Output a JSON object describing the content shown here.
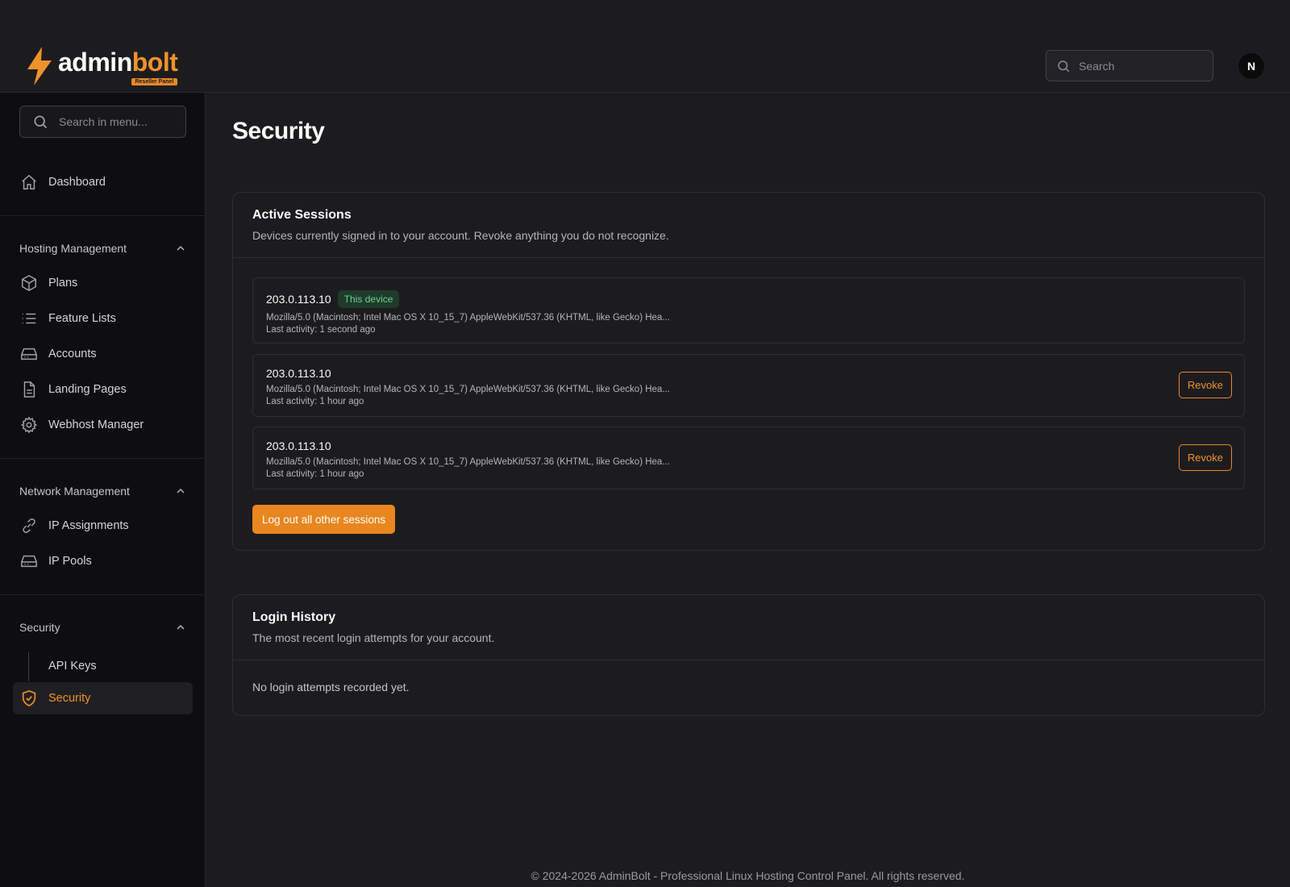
{
  "brand": {
    "name_part1": "admin",
    "name_part2": "bolt",
    "badge": "Reseller Panel",
    "accent_color": "#f0922b"
  },
  "header": {
    "search_placeholder": "Search",
    "avatar_initial": "N"
  },
  "sidebar": {
    "search_placeholder": "Search in menu...",
    "dashboard": {
      "label": "Dashboard",
      "icon": "home-icon"
    },
    "sections": [
      {
        "title": "Hosting Management",
        "items": [
          {
            "label": "Plans",
            "icon": "package-icon"
          },
          {
            "label": "Feature Lists",
            "icon": "list-icon"
          },
          {
            "label": "Accounts",
            "icon": "hard-drive-icon"
          },
          {
            "label": "Landing Pages",
            "icon": "file-text-icon"
          },
          {
            "label": "Webhost Manager",
            "icon": "gear-icon"
          }
        ]
      },
      {
        "title": "Network Management",
        "items": [
          {
            "label": "IP Assignments",
            "icon": "link-icon"
          },
          {
            "label": "IP Pools",
            "icon": "hard-drive-icon"
          }
        ]
      },
      {
        "title": "Security",
        "items": [
          {
            "label": "API Keys",
            "icon": ""
          },
          {
            "label": "Security",
            "icon": "shield-check-icon",
            "active": true
          }
        ]
      }
    ]
  },
  "page": {
    "title": "Security"
  },
  "active_sessions": {
    "title": "Active Sessions",
    "description": "Devices currently signed in to your account. Revoke anything you do not recognize.",
    "sessions": [
      {
        "ip": "203.0.113.10",
        "badge": "This device",
        "user_agent": "Mozilla/5.0 (Macintosh; Intel Mac OS X 10_15_7) AppleWebKit/537.36 (KHTML, like Gecko) Hea...",
        "last_activity": "Last activity: 1 second ago"
      },
      {
        "ip": "203.0.113.10",
        "user_agent": "Mozilla/5.0 (Macintosh; Intel Mac OS X 10_15_7) AppleWebKit/537.36 (KHTML, like Gecko) Hea...",
        "last_activity": "Last activity: 1 hour ago",
        "action": "Revoke"
      },
      {
        "ip": "203.0.113.10",
        "user_agent": "Mozilla/5.0 (Macintosh; Intel Mac OS X 10_15_7) AppleWebKit/537.36 (KHTML, like Gecko) Hea...",
        "last_activity": "Last activity: 1 hour ago",
        "action": "Revoke"
      }
    ],
    "logout_all_label": "Log out all other sessions"
  },
  "login_history": {
    "title": "Login History",
    "description": "The most recent login attempts for your account.",
    "empty_text": "No login attempts recorded yet."
  },
  "footer": {
    "text": "© 2024-2026 AdminBolt - Professional Linux Hosting Control Panel. All rights reserved."
  }
}
